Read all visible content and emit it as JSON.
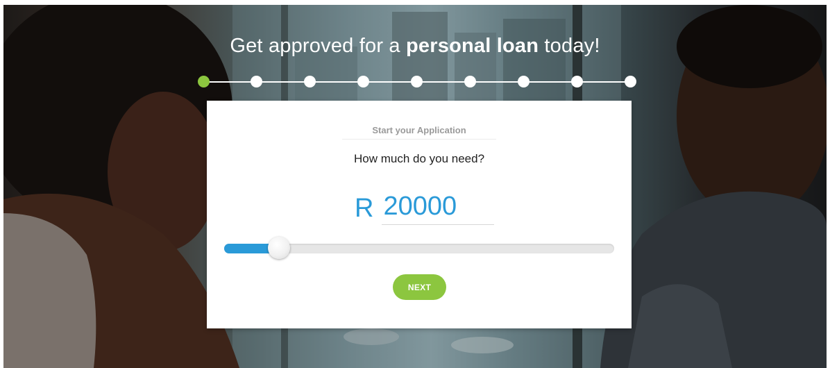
{
  "headline": {
    "prefix": "Get approved for a ",
    "emphasis": "personal loan",
    "suffix": " today!"
  },
  "stepper": {
    "total_steps": 9,
    "active_step": 1,
    "active_color": "#8cc63f",
    "inactive_color": "#ffffff"
  },
  "card": {
    "subtitle": "Start your Application",
    "question": "How much do you need?",
    "currency": "R",
    "amount_value": "20000",
    "slider_fraction": 0.14,
    "accent_color": "#2a9ad8",
    "next_label": "NEXT",
    "next_color": "#8cc63f"
  }
}
